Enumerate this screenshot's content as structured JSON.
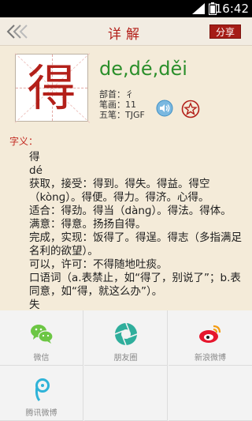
{
  "status": {
    "time": "16:42"
  },
  "header": {
    "title": "详解",
    "share_label": "分享"
  },
  "character": {
    "glyph": "得",
    "pinyin": "de,dé,děi",
    "radical": "部首：彳",
    "strokes": "笔画：11",
    "wubi": "五笔：TJGF"
  },
  "definitions": {
    "label": "字义：",
    "lines": [
      "得",
      "dé",
      "获取，接受：得到。得失。得益。得空（kònɡ）。得便。得力。得济。心得。",
      "适合：得劲。得当（dànɡ）。得法。得体。",
      "满意：得意。扬扬自得。",
      "完成，实现：饭得了。得逞。得志（多指满足名利的欲望）。",
      "可以，许可：不得随地吐痰。",
      "口语词（a.表禁止，如“得了，别说了”；b.表同意，如“得，就这么办”）。",
      "失"
    ]
  },
  "share_targets": [
    {
      "label": "微信",
      "icon": "wechat-icon",
      "color": "#6cc644"
    },
    {
      "label": "朋友圈",
      "icon": "moments-icon",
      "color": "#2fae9c"
    },
    {
      "label": "新浪微博",
      "icon": "weibo-icon",
      "color": "#e6162d"
    },
    {
      "label": "腾讯微博",
      "icon": "tencent-weibo-icon",
      "color": "#2fb3d8"
    }
  ]
}
